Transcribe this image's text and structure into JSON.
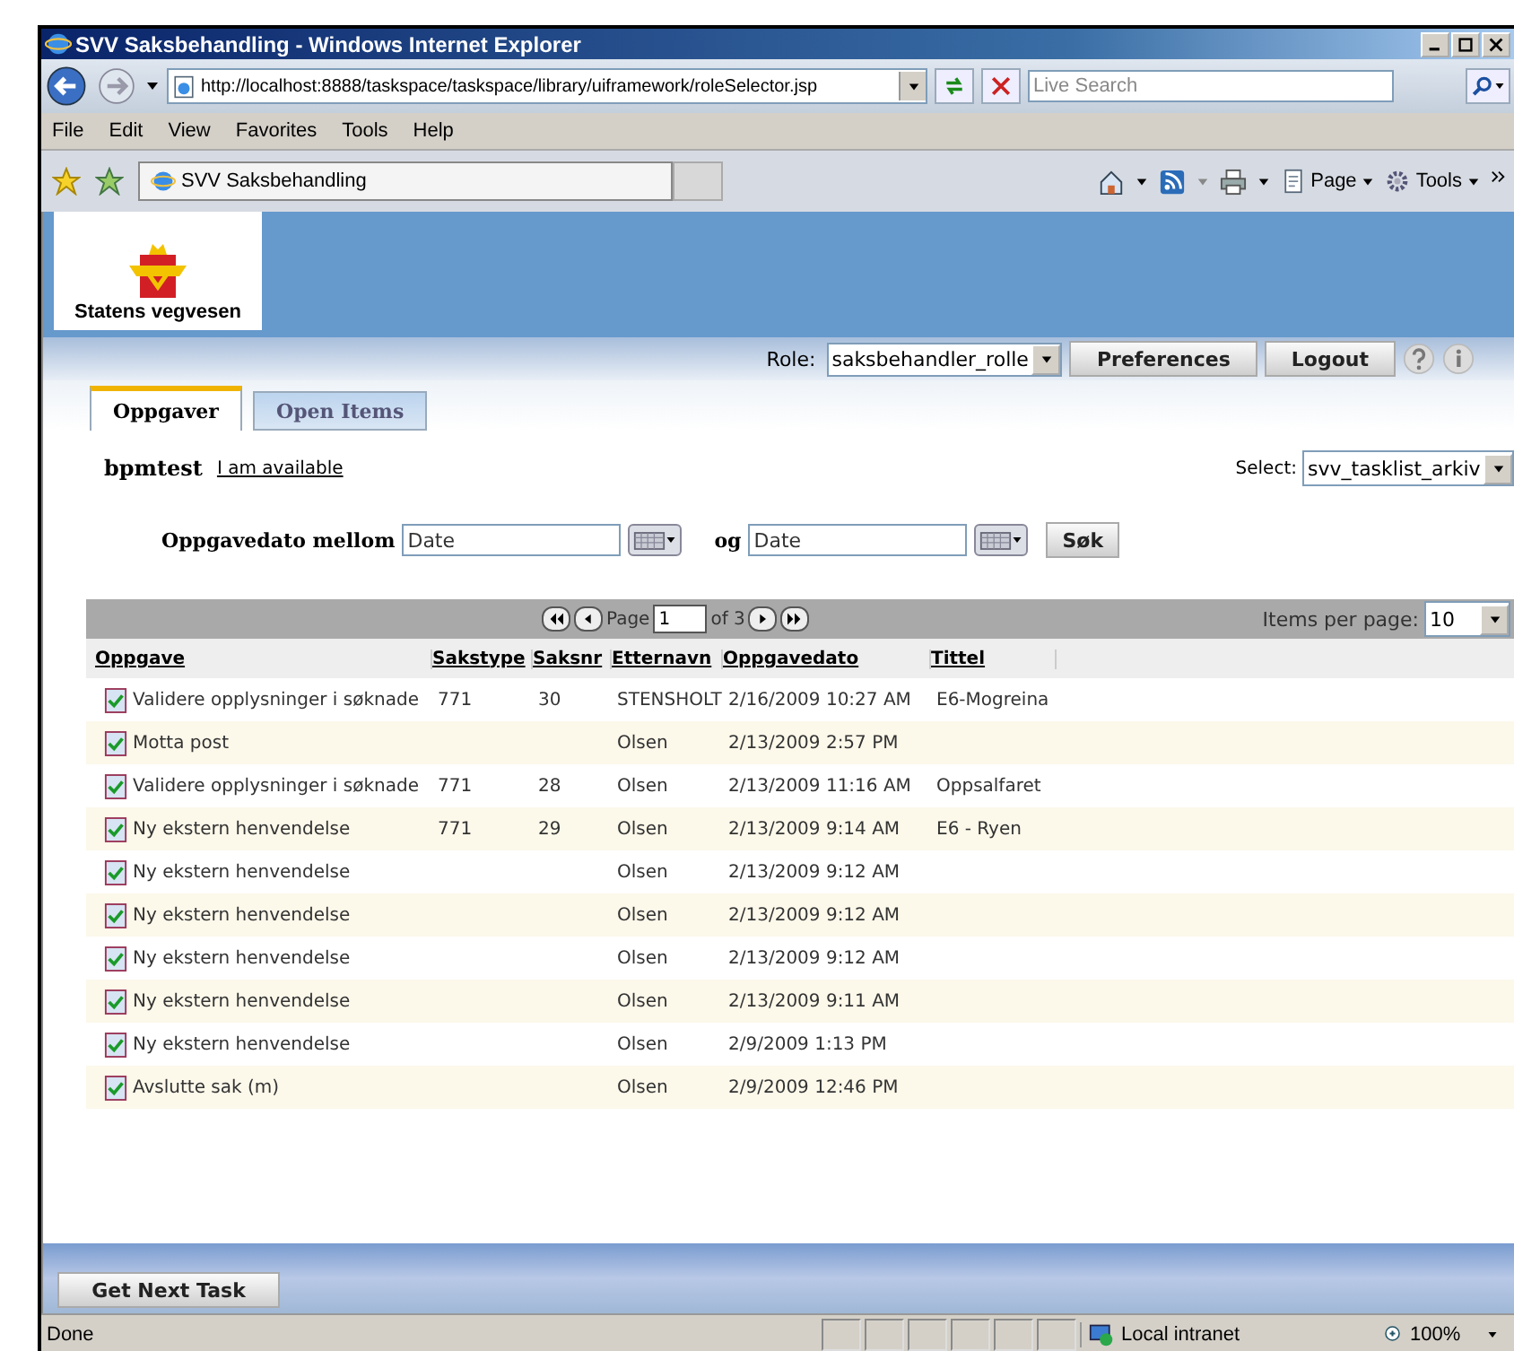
{
  "window": {
    "title": "SVV Saksbehandling - Windows Internet Explorer"
  },
  "address_bar": {
    "url": "http://localhost:8888/taskspace/taskspace/library/uiframework/roleSelector.jsp",
    "search_placeholder": "Live Search"
  },
  "menu": [
    "File",
    "Edit",
    "View",
    "Favorites",
    "Tools",
    "Help"
  ],
  "browser_tabs": [
    {
      "label": "SVV Saksbehandling",
      "selected": true
    }
  ],
  "command_bar": [
    "Page",
    "Tools"
  ],
  "app": {
    "logo_text": "Statens vegvesen",
    "role_label": "Role:",
    "role": "saksbehandler_rolle",
    "buttons": [
      "Preferences",
      "Logout"
    ]
  },
  "tabs": [
    {
      "label": "Oppgaver",
      "selected": true
    },
    {
      "label": "Open Items",
      "selected": false
    }
  ],
  "user": {
    "name": "bpmtest",
    "link": "I am available"
  },
  "queue": {
    "label": "Select:",
    "value": "svv_tasklist_arkiv"
  },
  "filter": {
    "label": "Oppgavedato mellom",
    "from_placeholder": "Date",
    "and_label": "og",
    "to_placeholder": "Date",
    "button": "Søk"
  },
  "pager": {
    "page_label": "Page",
    "page": "1",
    "of_label": "of 3",
    "items_label": "Items per page:",
    "items": "10"
  },
  "table": {
    "columns": [
      "Oppgave",
      "Sakstype",
      "Saksnr",
      "Etternavn",
      "Oppgavedato",
      "Tittel"
    ],
    "rows": [
      [
        "Validere opplysninger i søknade",
        "771",
        "30",
        "STENSHOLT",
        "2/16/2009 10:27 AM",
        "E6-Mogreina"
      ],
      [
        "Motta post",
        "",
        "",
        "Olsen",
        "2/13/2009 2:57 PM",
        ""
      ],
      [
        "Validere opplysninger i søknade",
        "771",
        "28",
        "Olsen",
        "2/13/2009 11:16 AM",
        "Oppsalfaret"
      ],
      [
        "Ny ekstern henvendelse",
        "771",
        "29",
        "Olsen",
        "2/13/2009 9:14 AM",
        "E6 - Ryen"
      ],
      [
        "Ny ekstern henvendelse",
        "",
        "",
        "Olsen",
        "2/13/2009 9:12 AM",
        ""
      ],
      [
        "Ny ekstern henvendelse",
        "",
        "",
        "Olsen",
        "2/13/2009 9:12 AM",
        ""
      ],
      [
        "Ny ekstern henvendelse",
        "",
        "",
        "Olsen",
        "2/13/2009 9:12 AM",
        ""
      ],
      [
        "Ny ekstern henvendelse",
        "",
        "",
        "Olsen",
        "2/13/2009 9:11 AM",
        ""
      ],
      [
        "Ny ekstern henvendelse",
        "",
        "",
        "Olsen",
        "2/9/2009 1:13 PM",
        ""
      ],
      [
        "Avslutte sak (m)",
        "",
        "",
        "Olsen",
        "2/9/2009 12:46 PM",
        ""
      ]
    ]
  },
  "footer_button": "Get Next Task",
  "status_bar": {
    "text": "Done",
    "zone": "Local intranet",
    "zoom": "100%"
  }
}
